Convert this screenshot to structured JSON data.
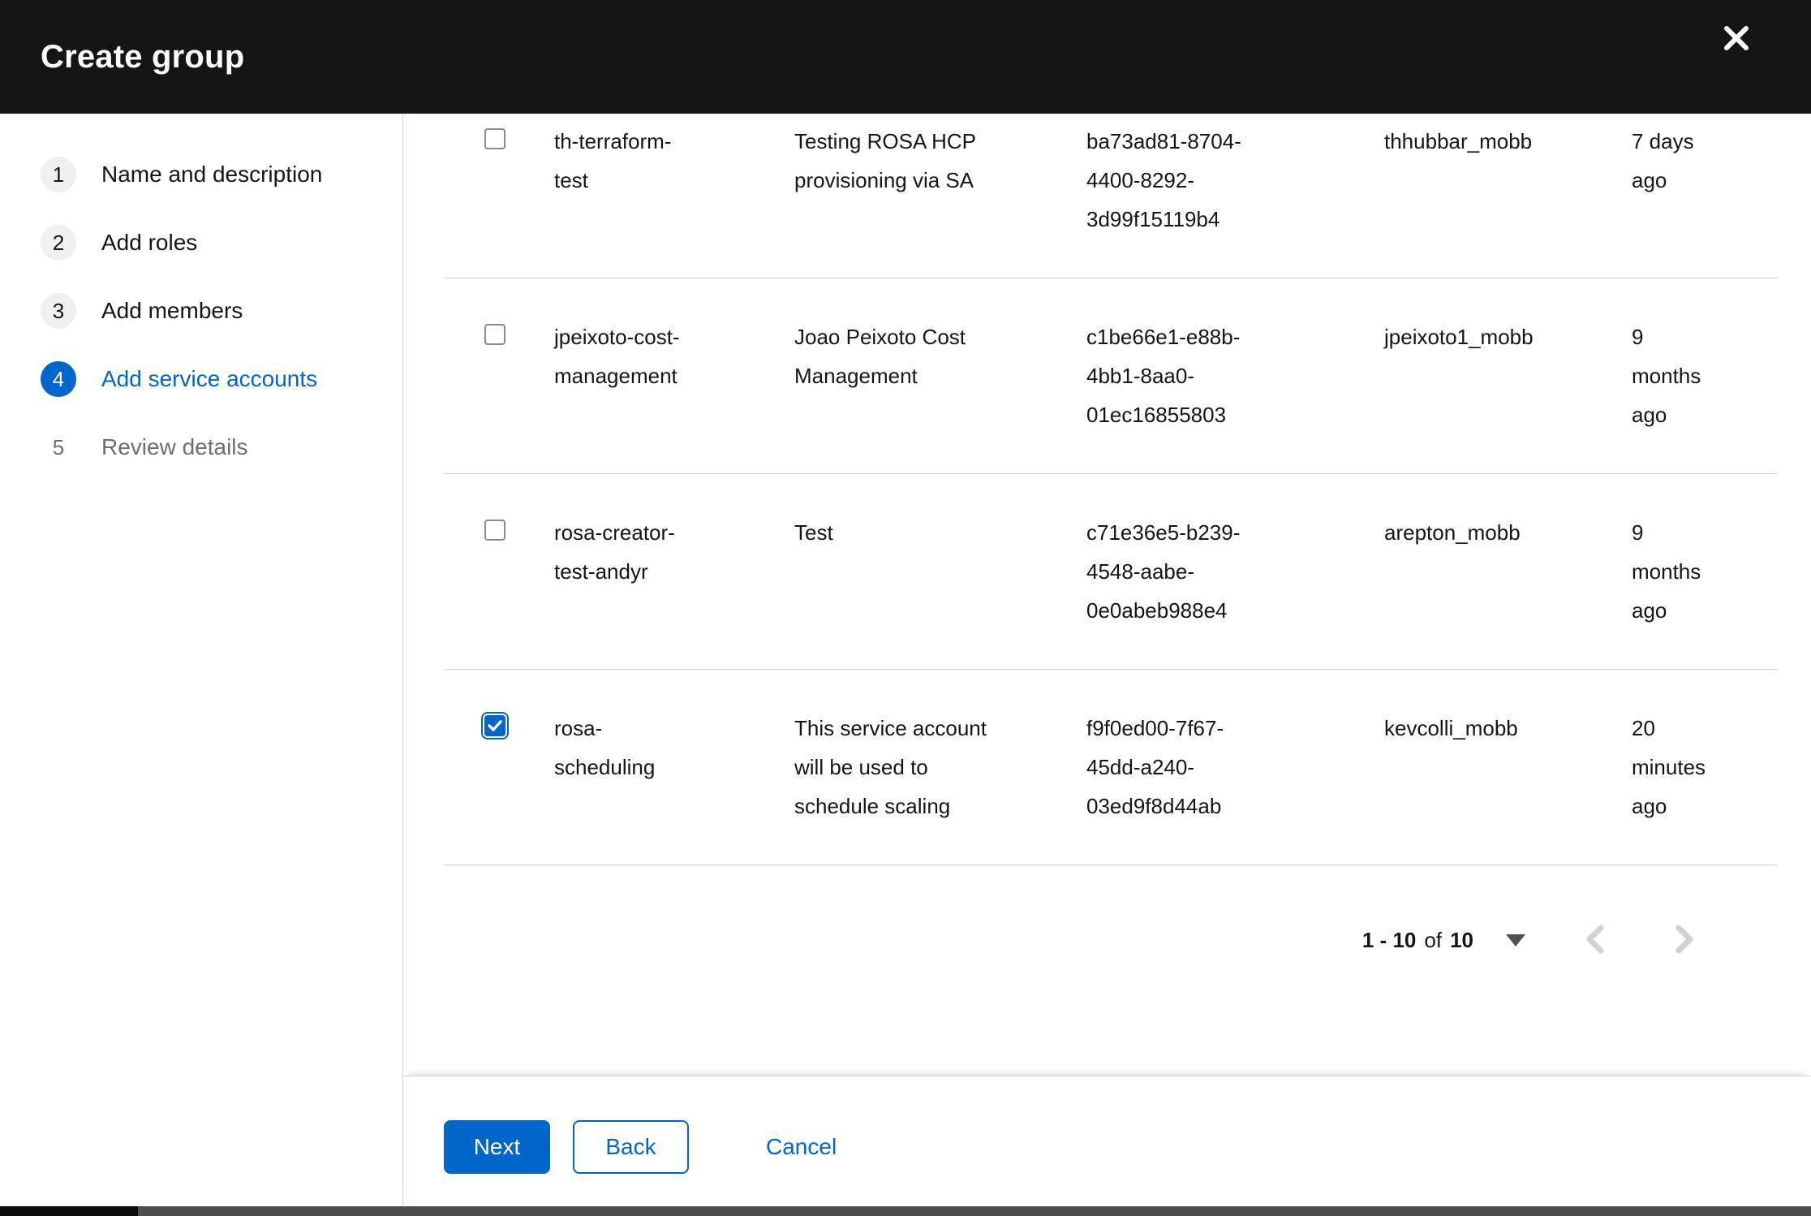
{
  "header": {
    "title": "Create group"
  },
  "wizard": {
    "steps": [
      {
        "num": "1",
        "label": "Name and description",
        "state": "visited"
      },
      {
        "num": "2",
        "label": "Add roles",
        "state": "visited"
      },
      {
        "num": "3",
        "label": "Add members",
        "state": "visited"
      },
      {
        "num": "4",
        "label": "Add service accounts",
        "state": "current"
      },
      {
        "num": "5",
        "label": "Review details",
        "state": "future"
      }
    ]
  },
  "table": {
    "rows": [
      {
        "checked": false,
        "name": "th-terraform-test",
        "description": "Testing ROSA HCP provisioning via SA",
        "client_id": "ba73ad81-8704-4400-8292-3d99f15119b4",
        "owner": "thhubbar_mobb",
        "time_created": "7 days ago"
      },
      {
        "checked": false,
        "name": "jpeixoto-cost-management",
        "description": "Joao Peixoto Cost Management",
        "client_id": "c1be66e1-e88b-4bb1-8aa0-01ec16855803",
        "owner": "jpeixoto1_mobb",
        "time_created": "9 months ago"
      },
      {
        "checked": false,
        "name": "rosa-creator-test-andyr",
        "description": "Test",
        "client_id": "c71e36e5-b239-4548-aabe-0e0abeb988e4",
        "owner": "arepton_mobb",
        "time_created": "9 months ago"
      },
      {
        "checked": true,
        "name": "rosa-scheduling",
        "description": "This service account will be used to schedule scaling",
        "client_id": "f9f0ed00-7f67-45dd-a240-03ed9f8d44ab",
        "owner": "kevcolli_mobb",
        "time_created": "20 minutes ago"
      }
    ]
  },
  "pagination": {
    "range": "1 - 10",
    "of_label": "of",
    "total": "10"
  },
  "footer": {
    "next_label": "Next",
    "back_label": "Back",
    "cancel_label": "Cancel"
  },
  "colors": {
    "primary": "#0066cc",
    "header_bg": "#151515",
    "separator": "#d2d2d2",
    "muted_text": "#6a6e73",
    "scrollbar_track": "#4d4d4d",
    "scrollbar_thumb": "#0a0a0a"
  }
}
